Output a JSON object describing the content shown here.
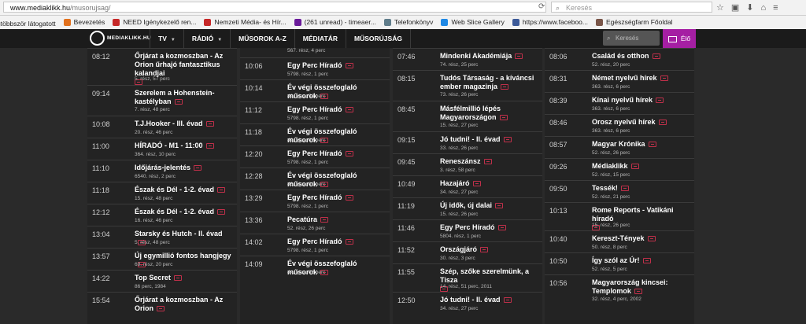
{
  "browser": {
    "url_host": "www.mediaklikk.hu",
    "url_path": "/musorujsag/",
    "search_placeholder": "Keresés",
    "bookmarks": [
      {
        "label": "gtöbbször látogatott",
        "color": "#7a7a7a"
      },
      {
        "label": "Bevezetés",
        "color": "#e2711d"
      },
      {
        "label": "NEED Igénykezelő ren...",
        "color": "#c62828"
      },
      {
        "label": "Nemzeti Média- és Hír...",
        "color": "#c62828"
      },
      {
        "label": "(261 unread) - timeaer...",
        "color": "#6a1b9a"
      },
      {
        "label": "Telefonkönyv",
        "color": "#607d8b"
      },
      {
        "label": "Web Slice Gallery",
        "color": "#1e88e5"
      },
      {
        "label": "https://www.faceboo...",
        "color": "#3b5998"
      },
      {
        "label": "Egészségfarm Főoldal",
        "color": "#795548"
      }
    ]
  },
  "nav": {
    "logo_text": "MEDIAKLIKK.HU",
    "items": [
      "TV",
      "RÁDIÓ",
      "MŰSOROK A-Z",
      "MÉDIATÁR",
      "MŰSORÚJSÁG"
    ],
    "search_placeholder": "Keresés",
    "live_label": "Élő"
  },
  "schedule": {
    "columns": [
      {
        "rows": [
          {
            "time": "08:12",
            "title": "Őrjárat a kozmoszban - Az Orion űrhajó fantasztikus kalandjai",
            "sub": "5. rész, 57 perc",
            "lines": 2,
            "link_newline": true
          },
          {
            "time": "09:14",
            "title": "Szerelem a Hohenstein-kastélyban",
            "sub": "7. rész, 48 perc",
            "lines": 2
          },
          {
            "time": "10:08",
            "title": "T.J.Hooker - III. évad",
            "sub": "20. rész, 46 perc",
            "lines": 1
          },
          {
            "time": "11:00",
            "title": "HÍRADÓ - M1 - 11:00",
            "sub": "364. rész, 10 perc",
            "lines": 1
          },
          {
            "time": "11:10",
            "title": "Időjárás-jelentés",
            "sub": "6540. rész, 2 perc",
            "lines": 1
          },
          {
            "time": "11:18",
            "title": "Észak és Dél - 1-2. évad",
            "sub": "15. rész, 48 perc",
            "lines": 1
          },
          {
            "time": "12:12",
            "title": "Észak és Dél - 1-2. évad",
            "sub": "16. rész, 46 perc",
            "lines": 1
          },
          {
            "time": "13:04",
            "title": "Starsky és Hutch - II. évad",
            "sub": "5. rész, 48 perc",
            "lines": 1
          },
          {
            "time": "13:57",
            "title": "Új egymillió fontos hangjegy",
            "sub": "69. rész, 20 perc",
            "lines": 1
          },
          {
            "time": "14:22",
            "title": "Top Secret",
            "sub": "86 perc, 1984",
            "lines": 1
          },
          {
            "time": "15:54",
            "title": "Őrjárat a kozmoszban - Az Orion",
            "sub": "",
            "lines": 1
          }
        ]
      },
      {
        "rows": [
          {
            "time": "10:06",
            "title": "Egy Perc Híradó",
            "sub": "5798. rész, 1 perc",
            "lines": 1
          },
          {
            "time": "10:14",
            "title": "Év végi összefoglaló műsorok",
            "sub": "42. rész, 58 perc",
            "lines": 1
          },
          {
            "time": "11:12",
            "title": "Egy Perc Híradó",
            "sub": "5798. rész, 1 perc",
            "lines": 1
          },
          {
            "time": "11:18",
            "title": "Év végi összefoglaló műsorok",
            "sub": "42. rész, 62 perc",
            "lines": 1
          },
          {
            "time": "12:20",
            "title": "Egy Perc Híradó",
            "sub": "5798. rész, 1 perc",
            "lines": 1
          },
          {
            "time": "12:28",
            "title": "Év végi összefoglaló műsorok",
            "sub": "43. rész, 61 perc",
            "lines": 1
          },
          {
            "time": "13:29",
            "title": "Egy Perc Híradó",
            "sub": "5798. rész, 1 perc",
            "lines": 1
          },
          {
            "time": "13:36",
            "title": "Pecatúra",
            "sub": "52. rész, 26 perc",
            "lines": 1
          },
          {
            "time": "14:02",
            "title": "Egy Perc Híradó",
            "sub": "5798. rész, 1 perc",
            "lines": 1
          },
          {
            "time": "14:09",
            "title": "Év végi összefoglaló műsorok",
            "sub": "44. rész, 62 perc",
            "lines": 1
          }
        ],
        "top_partial_sub": "567. rész, 4 perc"
      },
      {
        "rows": [
          {
            "time": "07:46",
            "title": "Mindenki Akadémiája",
            "sub": "74. rész, 25 perc",
            "lines": 1
          },
          {
            "time": "08:15",
            "title": "Tudós Társaság - a kíváncsi ember magazinja",
            "sub": "73. rész, 26 perc",
            "lines": 2
          },
          {
            "time": "08:45",
            "title": "Másfélmillió lépés Magyarországon",
            "sub": "15. rész, 27 perc",
            "lines": 2
          },
          {
            "time": "09:15",
            "title": "Jó tudni! - II. évad",
            "sub": "33. rész, 26 perc",
            "lines": 1
          },
          {
            "time": "09:45",
            "title": "Reneszánsz",
            "sub": "3. rész, 58 perc",
            "lines": 1
          },
          {
            "time": "10:49",
            "title": "Hazajáró",
            "sub": "34. rész, 27 perc",
            "lines": 1
          },
          {
            "time": "11:19",
            "title": "Új idők, új dalai",
            "sub": "15. rész, 26 perc",
            "lines": 1
          },
          {
            "time": "11:46",
            "title": "Egy Perc Híradó",
            "sub": "5804. rész, 1 perc",
            "lines": 1
          },
          {
            "time": "11:52",
            "title": "Országjáró",
            "sub": "30. rész, 3 perc",
            "lines": 1
          },
          {
            "time": "11:55",
            "title": "Szép, szőke szerelmünk, a Tisza",
            "sub": "14. rész, 51 perc, 2011",
            "lines": 1,
            "link_newline": true
          },
          {
            "time": "12:50",
            "title": "Jó tudni! - II. évad",
            "sub": "34. rész, 27 perc",
            "lines": 1
          }
        ]
      },
      {
        "rows": [
          {
            "time": "08:06",
            "title": "Család és otthon",
            "sub": "52. rész, 20 perc",
            "lines": 1
          },
          {
            "time": "08:31",
            "title": "Német nyelvű hírek",
            "sub": "363. rész, 6 perc",
            "lines": 1
          },
          {
            "time": "08:39",
            "title": "Kínai nyelvű hírek",
            "sub": "363. rész, 6 perc",
            "lines": 1
          },
          {
            "time": "08:46",
            "title": "Orosz nyelvű hírek",
            "sub": "363. rész, 6 perc",
            "lines": 1
          },
          {
            "time": "08:57",
            "title": "Magyar Krónika",
            "sub": "52. rész, 26 perc",
            "lines": 1
          },
          {
            "time": "09:26",
            "title": "Médiaklikk",
            "sub": "52. rész, 15 perc",
            "lines": 1
          },
          {
            "time": "09:50",
            "title": "Tessék!",
            "sub": "52. rész, 21 perc",
            "lines": 1
          },
          {
            "time": "10:13",
            "title": "Rome Reports - Vatikáni híradó",
            "sub": "15. rész, 26 perc",
            "lines": 1,
            "link_newline": true
          },
          {
            "time": "10:40",
            "title": "Kereszt-Tények",
            "sub": "50. rész, 8 perc",
            "lines": 1
          },
          {
            "time": "10:50",
            "title": "Így szól az Úr!",
            "sub": "52. rész, 5 perc",
            "lines": 1
          },
          {
            "time": "10:56",
            "title": "Magyarország kincsei: Templomok",
            "sub": "32. rész, 4 perc, 2002",
            "lines": 2
          }
        ]
      }
    ]
  }
}
